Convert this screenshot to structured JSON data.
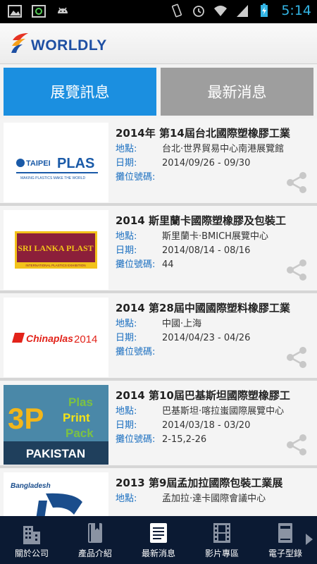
{
  "status_bar": {
    "time": "5:14"
  },
  "app": {
    "logo_text": "WORLDLY"
  },
  "tabs": [
    {
      "label": "展覽訊息",
      "active": true
    },
    {
      "label": "最新消息",
      "active": false
    }
  ],
  "field_labels": {
    "location": "地點:",
    "date": "日期:",
    "booth": "攤位號碼:"
  },
  "exhibitions": [
    {
      "title": "2014年 第14屆台北國際塑橡膠工業",
      "location": "台北·世界貿易中心南港展覽館",
      "date": "2014/09/26 - 09/30",
      "booth": "",
      "logo": "taipei-plas"
    },
    {
      "title": "2014 斯里蘭卡國際塑橡膠及包裝工",
      "location": "斯里蘭卡·BMICH展覽中心",
      "date": "2014/08/14 - 08/16",
      "booth": "44",
      "logo": "sri-lanka-plast"
    },
    {
      "title": "2014 第28屆中國國際塑料橡膠工業",
      "location": "中國·上海",
      "date": "2014/04/23 - 04/26",
      "booth": "",
      "logo": "chinaplas"
    },
    {
      "title": "2014 第10屆巴基斯坦國際塑橡膠工",
      "location": "巴基斯坦·喀拉蚩國際展覽中心",
      "date": "2014/03/18 - 03/20",
      "booth": "2-15,2-26",
      "logo": "3p-pakistan"
    },
    {
      "title": "2013 第9屆孟加拉國際包裝工業展",
      "location": "孟加拉·達卡國際會議中心",
      "date": "",
      "booth": "",
      "logo": "bangladesh"
    }
  ],
  "logo_texts": {
    "taipei_plas_a": "TAIPEI",
    "taipei_plas_b": "PLAS",
    "taipei_plas_tag": "MAKING PLASTICS MAKE THE WORLD",
    "sri_lanka": "SRI LANKA PLAST",
    "sri_lanka_sub": "INTERNATIONAL PLASTICS EXHIBITION",
    "chinaplas": "Chinaplas",
    "chinaplas_year": "2014",
    "p3_a": "3P",
    "p3_b": "Plas",
    "p3_c": "Print",
    "p3_d": "Pack",
    "p3_country": "PAKISTAN",
    "bangladesh": "Bangladesh"
  },
  "bottom_nav": [
    {
      "label": "關於公司",
      "icon": "building-icon",
      "active": false
    },
    {
      "label": "產品介紹",
      "icon": "book-icon",
      "active": false
    },
    {
      "label": "最新消息",
      "icon": "news-icon",
      "active": true
    },
    {
      "label": "影片專區",
      "icon": "film-icon",
      "active": false
    },
    {
      "label": "電子型錄",
      "icon": "catalog-icon",
      "active": false
    }
  ],
  "colors": {
    "accent": "#1b8fe0",
    "nav_bg": "#0b1a33",
    "label_blue": "#1b6fc0"
  }
}
